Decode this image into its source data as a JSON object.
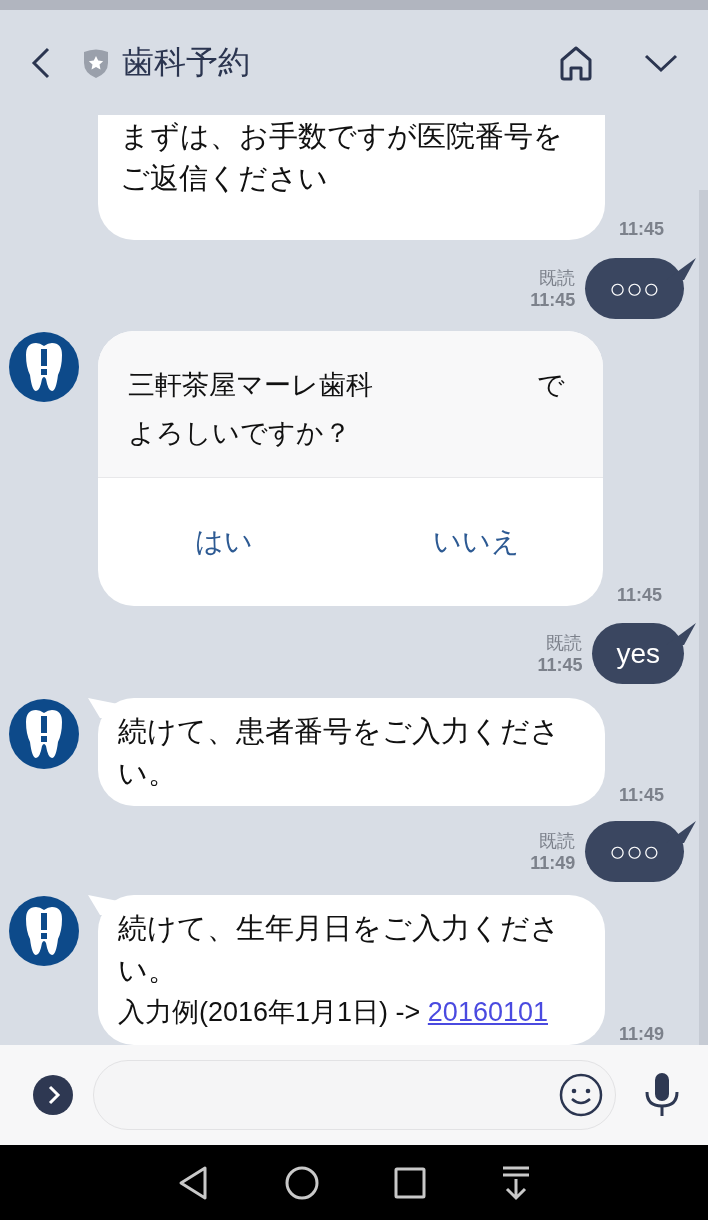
{
  "header": {
    "title": "歯科予約"
  },
  "messages": [
    {
      "kind": "received",
      "avatar": false,
      "cut": true,
      "text": "まずは、お手数ですが医院番号をご返信ください",
      "time": "11:45"
    },
    {
      "kind": "sent",
      "text": "○○○",
      "read": "既読",
      "time": "11:45"
    },
    {
      "kind": "confirm",
      "avatar": true,
      "name": "三軒茶屋マーレ歯科",
      "suffix": "で",
      "question": "よろしいですか？",
      "actions": [
        "はい",
        "いいえ"
      ],
      "time": "11:45"
    },
    {
      "kind": "sent",
      "text": "yes",
      "read": "既読",
      "time": "11:45"
    },
    {
      "kind": "received",
      "avatar": true,
      "cut": false,
      "text": "続けて、患者番号をご入力ください。",
      "time": "11:45"
    },
    {
      "kind": "sent",
      "text": "○○○",
      "read": "既読",
      "time": "11:49"
    },
    {
      "kind": "received",
      "avatar": true,
      "cut": false,
      "text": "続けて、生年月日をご入力ください。",
      "example": "入力例(2016年1月1日) -> ",
      "link": "20160101",
      "time": "11:49"
    }
  ]
}
